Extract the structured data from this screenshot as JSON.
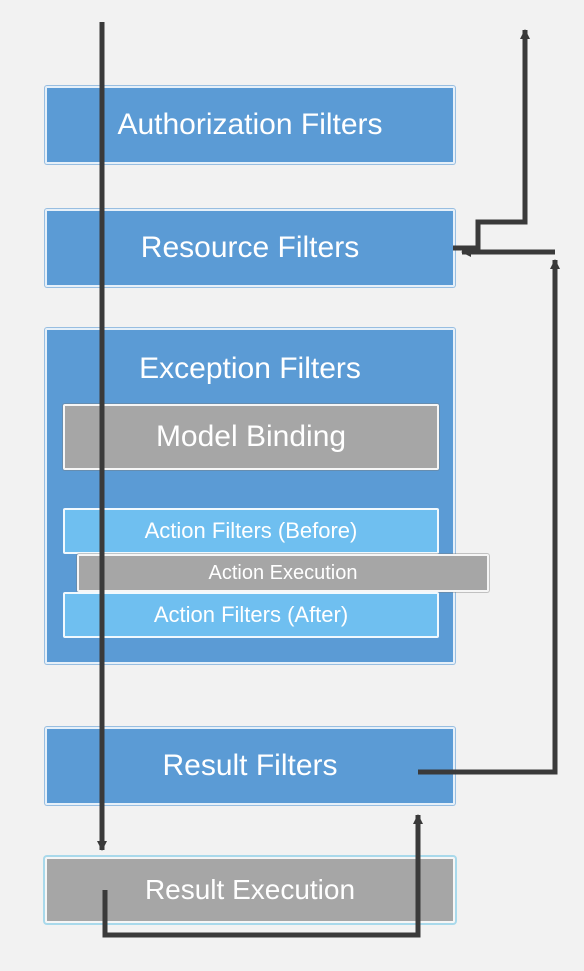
{
  "diagram": {
    "authorization": "Authorization Filters",
    "resource": "Resource Filters",
    "exception": "Exception Filters",
    "model_binding": "Model Binding",
    "action_before": "Action Filters  (Before)",
    "action_execution": "Action Execution",
    "action_after": "Action Filters  (After)",
    "result": "Result Filters",
    "result_execution": "Result Execution"
  },
  "colors": {
    "blue": "#5b9bd5",
    "gray": "#a6a6a6",
    "lightblue": "#6fbff0",
    "arrow": "#3a3a3a"
  }
}
